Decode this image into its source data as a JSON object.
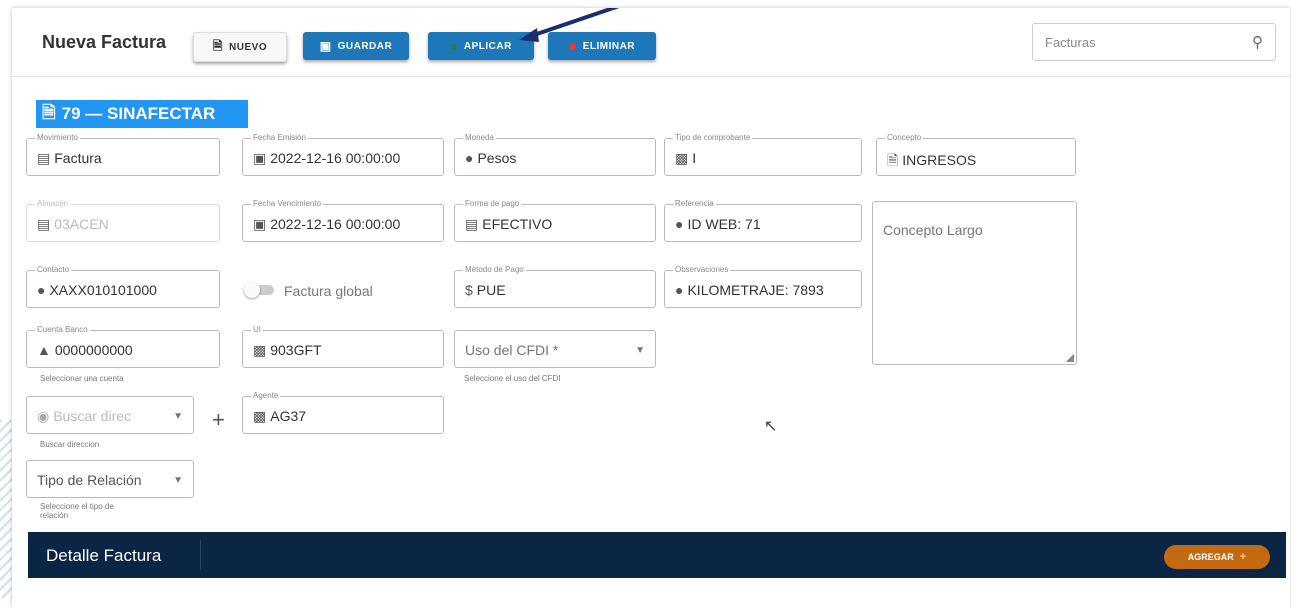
{
  "header": {
    "title": "Nueva Factura",
    "buttons": {
      "nuevo": "NUEVO",
      "guardar": "GUARDAR",
      "aplicar": "APLICAR",
      "eliminar": "ELIMINAR"
    },
    "search_placeholder": "Facturas"
  },
  "badge": "79 — SINAFECTAR",
  "fields": {
    "movimiento": {
      "label": "Movimiento",
      "value": "Factura"
    },
    "fecha_emision": {
      "label": "Fecha Emisión",
      "value": "2022-12-16 00:00:00"
    },
    "moneda": {
      "label": "Moneda",
      "value": "Pesos"
    },
    "tipo_comprobante": {
      "label": "Tipo de comprobante",
      "value": "I"
    },
    "concepto": {
      "label": "Concepto",
      "value": "INGRESOS"
    },
    "almacen": {
      "label": "Almacén",
      "value": "03ACEN"
    },
    "fecha_vencimiento": {
      "label": "Fecha Vencimiento",
      "value": "2022-12-16 00:00:00"
    },
    "forma_pago": {
      "label": "Forma de pago",
      "value": "EFECTIVO"
    },
    "referencia": {
      "label": "Referencia",
      "value": "ID WEB: 71"
    },
    "concepto_largo": {
      "placeholder": "Concepto Largo"
    },
    "contacto": {
      "label": "Contacto",
      "value": "XAXX010101000"
    },
    "factura_global": "Factura global",
    "metodo_pago": {
      "label": "Método de Pago",
      "value": "PUE"
    },
    "observaciones": {
      "label": "Observaciones",
      "value": "KILOMETRAJE: 7893"
    },
    "cuenta_banco": {
      "label": "Cuenta Banco",
      "value": "0000000000",
      "hint": "Seleccionar una cuenta"
    },
    "ui": {
      "label": "UI",
      "value": "903GFT"
    },
    "uso_cfdi": {
      "value": "Uso del CFDI *",
      "hint": "Seleccione el uso del CFDI"
    },
    "buscar_direccion": {
      "value": "Buscar direc",
      "hint": "Buscar direccion"
    },
    "agente": {
      "label": "Agente",
      "value": "AG37"
    },
    "tipo_relacion": {
      "value": "Tipo de Relación",
      "hint": "Seleccione el tipo de relación"
    }
  },
  "detail": {
    "title": "Detalle Factura",
    "agregar": "AGREGAR"
  }
}
